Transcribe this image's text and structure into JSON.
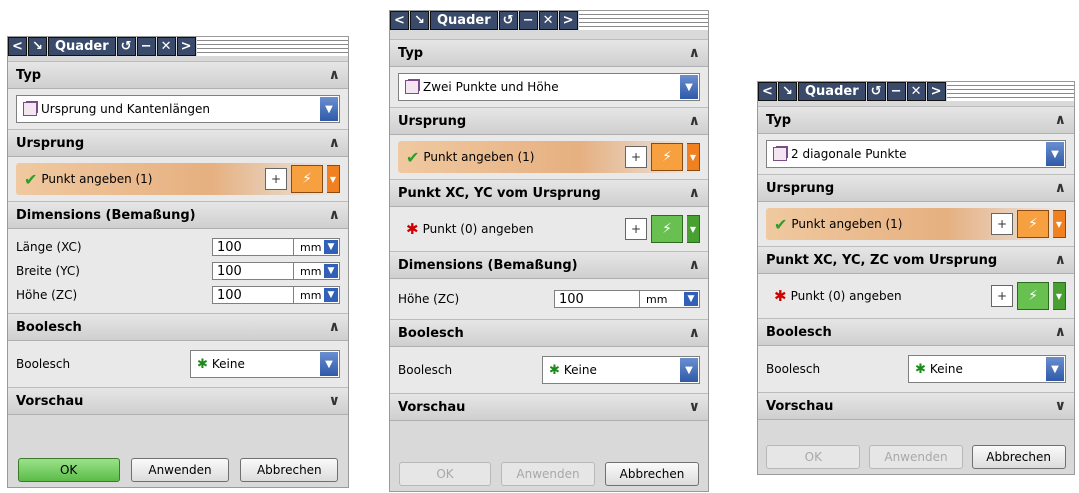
{
  "title": "Quader",
  "dialogs": [
    {
      "typ_label": "Typ",
      "typ_value": "Ursprung und Kantenlängen",
      "ursprung_label": "Ursprung",
      "punkt_label": "Punkt angeben (1)",
      "dims_label": "Dimensions (Bemaßung)",
      "dims": [
        {
          "label": "Länge (XC)",
          "value": "100",
          "unit": "mm"
        },
        {
          "label": "Breite (YC)",
          "value": "100",
          "unit": "mm"
        },
        {
          "label": "Höhe (ZC)",
          "value": "100",
          "unit": "mm"
        }
      ],
      "bool_section": "Boolesch",
      "bool_label": "Boolesch",
      "bool_value": "Keine",
      "vorschau": "Vorschau",
      "ok": "OK",
      "anwenden": "Anwenden",
      "abbrechen": "Abbrechen"
    },
    {
      "typ_label": "Typ",
      "typ_value": "Zwei Punkte und Höhe",
      "ursprung_label": "Ursprung",
      "punkt_label": "Punkt angeben (1)",
      "punkt2_section": "Punkt XC, YC vom Ursprung",
      "punkt2_label": "Punkt (0) angeben",
      "dims_label": "Dimensions (Bemaßung)",
      "dims": [
        {
          "label": "Höhe (ZC)",
          "value": "100",
          "unit": "mm"
        }
      ],
      "bool_section": "Boolesch",
      "bool_label": "Boolesch",
      "bool_value": "Keine",
      "vorschau": "Vorschau",
      "ok": "OK",
      "anwenden": "Anwenden",
      "abbrechen": "Abbrechen"
    },
    {
      "typ_label": "Typ",
      "typ_value": "2 diagonale Punkte",
      "ursprung_label": "Ursprung",
      "punkt_label": "Punkt angeben (1)",
      "punkt2_section": "Punkt XC, YC, ZC vom Ursprung",
      "punkt2_label": "Punkt (0) angeben",
      "bool_section": "Boolesch",
      "bool_label": "Boolesch",
      "bool_value": "Keine",
      "vorschau": "Vorschau",
      "ok": "OK",
      "anwenden": "Anwenden",
      "abbrechen": "Abbrechen"
    }
  ]
}
